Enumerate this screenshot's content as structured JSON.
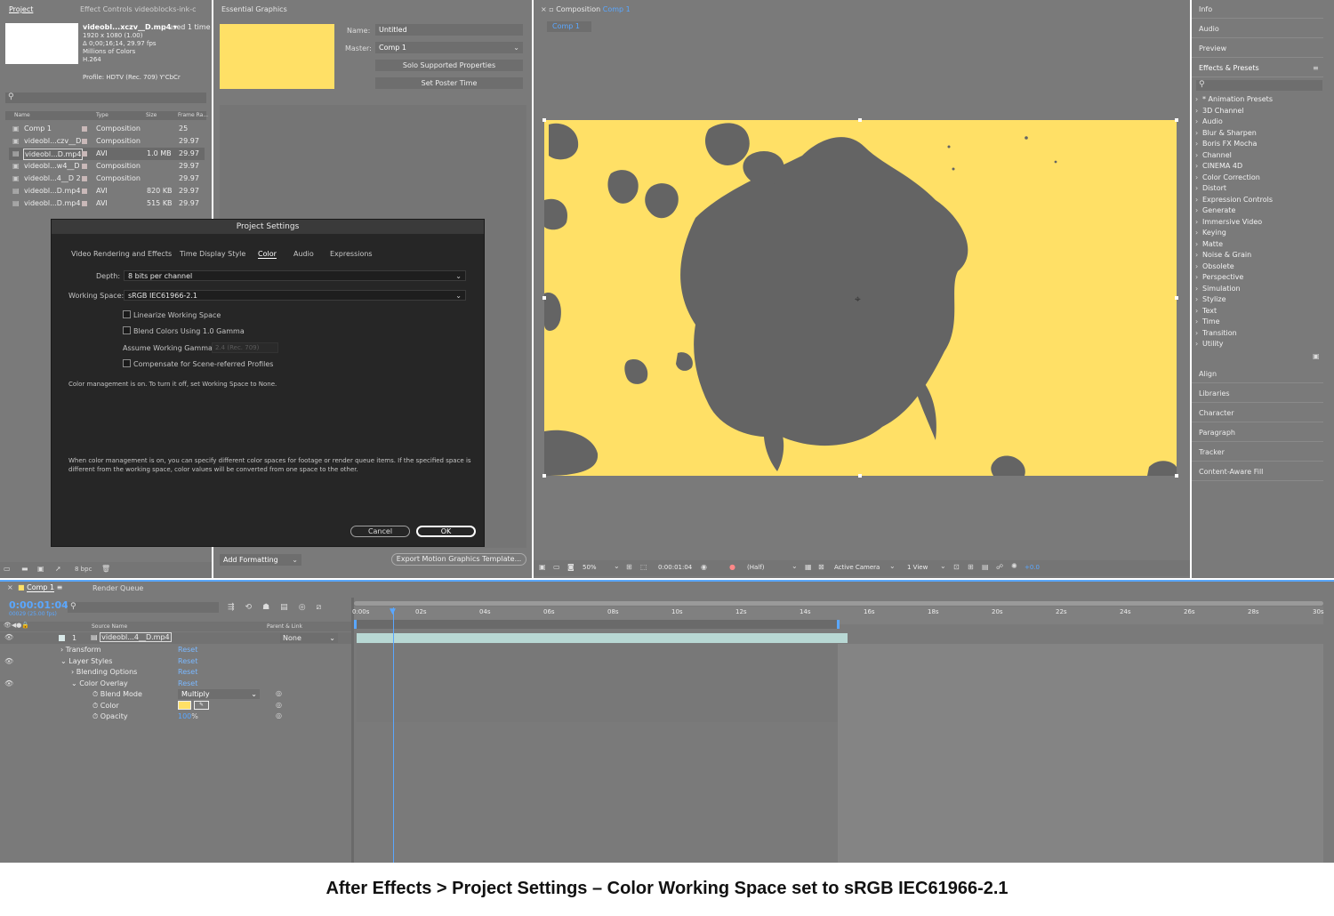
{
  "caption": "After Effects > Project Settings – Color Working Space set to sRGB IEC61966-2.1",
  "colors": {
    "accent": "#5aa7ff",
    "overlay_yellow": "#ffe066",
    "splash_gray": "#646464",
    "panel": "#7a7a7a"
  },
  "project": {
    "tab": "Project",
    "effect_controls_tab": "Effect Controls videoblocks-ink-c",
    "file_name": "videobl...xczv__D.mp4 ▾",
    "used": ", used 1 time",
    "resolution": "1920 x 1080 (1.00)",
    "duration": "Δ 0;00;16;14, 29.97 fps",
    "colors_info": "Millions of Colors",
    "codec": "H.264",
    "profile": "Profile: HDTV (Rec. 709) Y'CbCr",
    "columns": [
      "Name",
      "Type",
      "Size",
      "Frame Ra..."
    ],
    "rows": [
      {
        "name": "Comp 1",
        "type": "Composition",
        "size": "",
        "fps": "25"
      },
      {
        "name": "videobl...czv__D",
        "type": "Composition",
        "size": "",
        "fps": "29.97"
      },
      {
        "name": "videobl...D.mp4",
        "type": "AVI",
        "size": "1.0 MB",
        "fps": "29.97"
      },
      {
        "name": "videobl...w4__D",
        "type": "Composition",
        "size": "",
        "fps": "29.97"
      },
      {
        "name": "videobl...4__D 2",
        "type": "Composition",
        "size": "",
        "fps": "29.97"
      },
      {
        "name": "videobl...D.mp4",
        "type": "AVI",
        "size": "820 KB",
        "fps": "29.97"
      },
      {
        "name": "videobl...D.mp4",
        "type": "AVI",
        "size": "515 KB",
        "fps": "29.97"
      }
    ],
    "bpc": "8 bpc"
  },
  "essential_graphics": {
    "title": "Essential Graphics",
    "name_label": "Name:",
    "name_value": "Untitled",
    "master_label": "Master:",
    "master_value": "Comp 1",
    "solo_btn": "Solo Supported Properties",
    "poster_btn": "Set Poster Time",
    "add_formatting": "Add Formatting",
    "export_btn": "Export Motion Graphics Template..."
  },
  "composition": {
    "title": "Composition",
    "title_comp": "Comp 1",
    "tab": "Comp 1",
    "zoom": "50%",
    "timecode": "0:00:01:04",
    "resolution": "(Half)",
    "camera": "Active Camera",
    "view": "1 View",
    "exposure": "+0.0"
  },
  "right_panel": {
    "top_items": [
      "Info",
      "Audio",
      "Preview"
    ],
    "effects_title": "Effects & Presets",
    "effects": [
      "* Animation Presets",
      "3D Channel",
      "Audio",
      "Blur & Sharpen",
      "Boris FX Mocha",
      "Channel",
      "CINEMA 4D",
      "Color Correction",
      "Distort",
      "Expression Controls",
      "Generate",
      "Immersive Video",
      "Keying",
      "Matte",
      "Noise & Grain",
      "Obsolete",
      "Perspective",
      "Simulation",
      "Stylize",
      "Text",
      "Time",
      "Transition",
      "Utility"
    ],
    "bottom_items": [
      "Align",
      "Libraries",
      "Character",
      "Paragraph",
      "Tracker",
      "Content-Aware Fill"
    ]
  },
  "dialog": {
    "title": "Project Settings",
    "tabs": [
      "Video Rendering and Effects",
      "Time Display Style",
      "Color",
      "Audio",
      "Expressions"
    ],
    "depth_label": "Depth:",
    "depth_value": "8 bits per channel",
    "ws_label": "Working Space:",
    "ws_value": "sRGB IEC61966-2.1",
    "chk1": "Linearize Working Space",
    "chk2": "Blend Colors Using 1.0 Gamma",
    "gamma_label": "Assume Working Gamma:",
    "gamma_value": "2.4 (Rec. 709)",
    "chk3": "Compensate for Scene-referred Profiles",
    "note1": "Color management is on. To turn it off, set Working Space to None.",
    "note2a": "When color management is on, you can specify different color spaces for footage or render queue items. If the specified space is",
    "note2b": "different from the working space, color values will be converted from one space to the other.",
    "cancel": "Cancel",
    "ok": "OK"
  },
  "timeline": {
    "tab": "Comp 1",
    "render_tab": "Render Queue",
    "timecode": "0:00:01:04",
    "fps": "00029 (25.00 fps)",
    "col_source": "Source Name",
    "col_parent": "Parent & Link",
    "layer_num": "1",
    "layer_name": "videobl...4__D.mp4",
    "parent": "None",
    "props": [
      {
        "label": "Transform",
        "reset": "Reset"
      },
      {
        "label": "Layer Styles",
        "reset": "Reset"
      },
      {
        "label": "Blending Options",
        "reset": "Reset"
      },
      {
        "label": "Color Overlay",
        "reset": "Reset"
      }
    ],
    "blend_mode_label": "Blend Mode",
    "blend_mode_value": "Multiply",
    "color_label": "Color",
    "opacity_label": "Opacity",
    "opacity_value": "100",
    "opacity_unit": "%",
    "ruler": [
      "0:00s",
      "02s",
      "04s",
      "06s",
      "08s",
      "10s",
      "12s",
      "14s",
      "16s",
      "18s",
      "20s",
      "22s",
      "24s",
      "26s",
      "28s",
      "30s"
    ]
  }
}
